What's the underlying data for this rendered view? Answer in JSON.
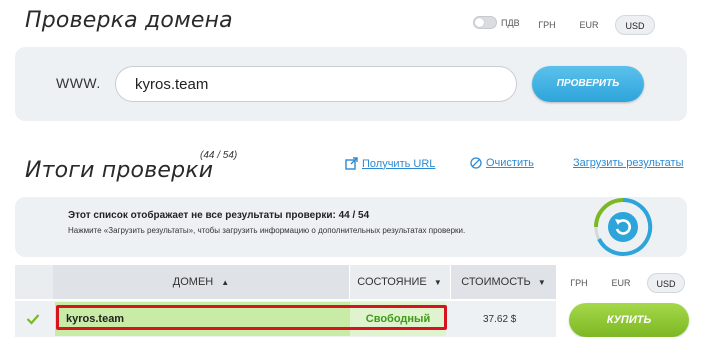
{
  "header": {
    "title": "Проверка домена"
  },
  "vat": {
    "label": "ПДВ",
    "enabled": false
  },
  "currency_top": {
    "options": [
      "ГРН",
      "EUR",
      "USD"
    ],
    "selected": "USD"
  },
  "search": {
    "prefix": "WWW.",
    "value": "kyros.team",
    "button": "ПРОВЕРИТЬ"
  },
  "results": {
    "title": "Итоги проверки",
    "count": "(44 / 54)",
    "links": {
      "get_url": "Получить URL",
      "clear": "Очистить",
      "load": "Загрузить результаты"
    },
    "info_main": "Этот список отображает не все результаты проверки: 44 / 54",
    "info_sub": "Нажмите «Загрузить результаты», чтобы загрузить информацию о дополнительных результатах проверки."
  },
  "table": {
    "headers": {
      "domain": "ДОМЕН",
      "status": "СОСТОЯНИЕ",
      "cost": "СТОИМОСТЬ"
    },
    "currency": {
      "options": [
        "ГРН",
        "EUR",
        "USD"
      ],
      "selected": "USD"
    },
    "rows": [
      {
        "domain": "kyros.team",
        "status": "Свободный",
        "price": "37.62 $",
        "action": "КУПИТЬ"
      }
    ]
  },
  "colors": {
    "accent_blue": "#2da4da",
    "accent_green": "#7cb823",
    "status_green": "#3c9a18",
    "highlight_red": "#d6141d"
  },
  "icons": {
    "get_url": "external-link-icon",
    "clear": "cancel-icon",
    "row_check": "checkmark-icon",
    "refresh": "refresh-icon",
    "sort": "sort-arrows-icon",
    "dropdown": "triangle-down-icon"
  }
}
